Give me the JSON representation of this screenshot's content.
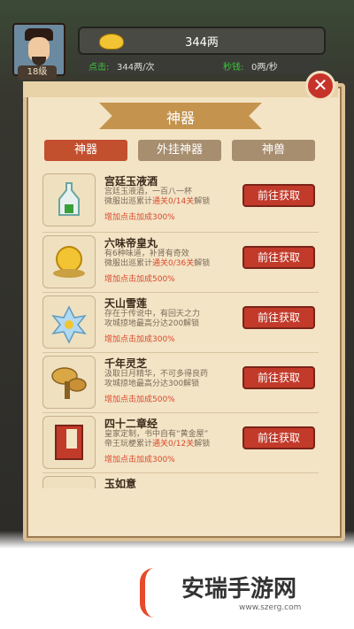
{
  "hud": {
    "level": "18级",
    "coins": "344两",
    "tap_label": "点击:",
    "tap_rate": "344两/次",
    "sec_label": "秒钱:",
    "sec_rate": "0两/秒"
  },
  "panel": {
    "title": "神器",
    "close": "✕",
    "tabs": [
      "神器",
      "外挂神器",
      "神兽"
    ]
  },
  "items": [
    {
      "name": "宫廷玉液酒",
      "desc1": "宫廷玉液酒，一百八一杯",
      "desc2a": "微服出巡累计",
      "desc2b": "通关0/14关",
      "desc2c": "解锁",
      "bonus": "增加点击加成300%",
      "button": "前往获取"
    },
    {
      "name": "六味帝皇丸",
      "desc1": "有6种味道，补肾有奇效",
      "desc2a": "微服出巡累计",
      "desc2b": "通关0/36关",
      "desc2c": "解锁",
      "bonus": "增加点击加成500%",
      "button": "前往获取"
    },
    {
      "name": "天山雪莲",
      "desc1": "存在于传说中，有回天之力",
      "desc2a": "攻城掠地最高分达200解锁",
      "desc2b": "",
      "desc2c": "",
      "bonus": "增加点击加成300%",
      "button": "前往获取"
    },
    {
      "name": "千年灵芝",
      "desc1": "汲取日月精华，不可多得良药",
      "desc2a": "攻城掠地最高分达300解锁",
      "desc2b": "",
      "desc2c": "",
      "bonus": "增加点击加成500%",
      "button": "前往获取"
    },
    {
      "name": "四十二章经",
      "desc1": "皇家定制，书中自有“黄金屋”",
      "desc2a": "帝王玩梗累计",
      "desc2b": "通关0/12关",
      "desc2c": "解锁",
      "bonus": "增加点击加成300%",
      "button": "前往获取"
    },
    {
      "name": "玉如意",
      "desc1": "",
      "desc2a": "",
      "desc2b": "",
      "desc2c": "",
      "bonus": "",
      "button": ""
    }
  ],
  "watermark": {
    "text": "安瑞手游网",
    "url": "www.szerg.com"
  }
}
